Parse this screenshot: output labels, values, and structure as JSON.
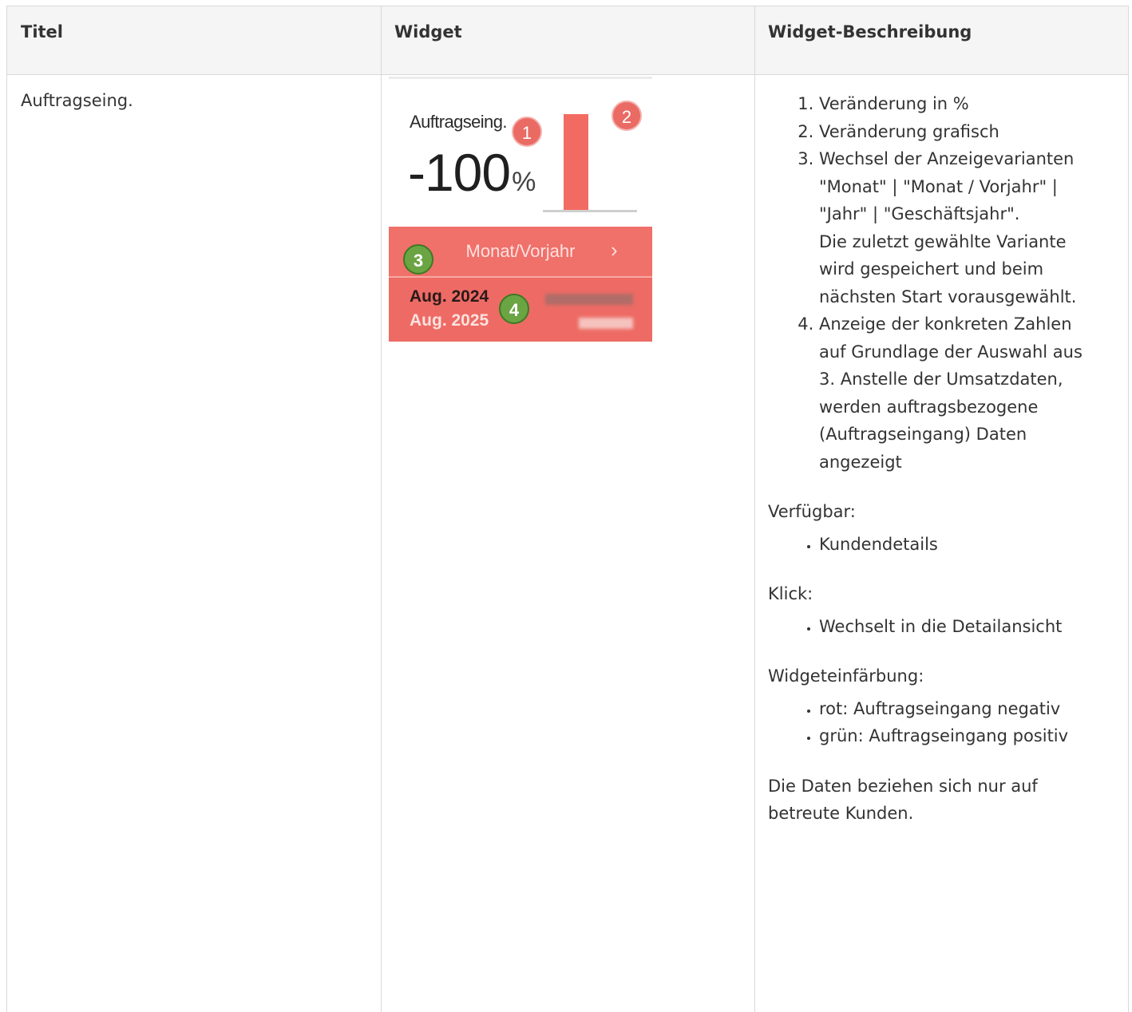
{
  "table": {
    "headers": [
      "Titel",
      "Widget",
      "Widget-Beschreibung"
    ]
  },
  "row": {
    "title": "Auftragseing.",
    "widget": {
      "title": "Auftragseing.",
      "percent_value": "-100",
      "percent_unit": "%",
      "nav_label": "Monat/Vorjahr",
      "nav_prev": "‹",
      "nav_next": "›",
      "date_current": "Aug. 2024",
      "date_previous": "Aug. 2025",
      "badges": [
        "1",
        "2",
        "3",
        "4"
      ],
      "colors": {
        "negative": "#f0706a",
        "badge_red": "#ea6a64",
        "badge_green": "#6aa443"
      }
    },
    "description": {
      "items": [
        "Veränderung in %",
        "Veränderung grafisch",
        "Wechsel der Anzeigevarianten \"Monat\" | \"Monat / Vorjahr\" | \"Jahr\" | \"Geschäftsjahr\".",
        "Anzeige der konkreten Zahlen auf Grundlage der Auswahl aus 3. Anstelle der Umsatzdaten, werden auftragsbezogene (Auftragseingang) Daten angezeigt"
      ],
      "item3_extra": "Die zuletzt gewählte Variante wird gespeichert und beim nächsten Start vorausgewählt.",
      "available_label": "Verfügbar:",
      "available_items": [
        "Kundendetails"
      ],
      "click_label": "Klick:",
      "click_items": [
        "Wechselt in die Detailansicht"
      ],
      "coloring_label": "Widgeteinfärbung:",
      "coloring_items": [
        "rot: Auftragseingang negativ",
        "grün: Auftragseingang positiv"
      ],
      "note": "Die Daten beziehen sich nur auf betreute Kunden."
    }
  }
}
